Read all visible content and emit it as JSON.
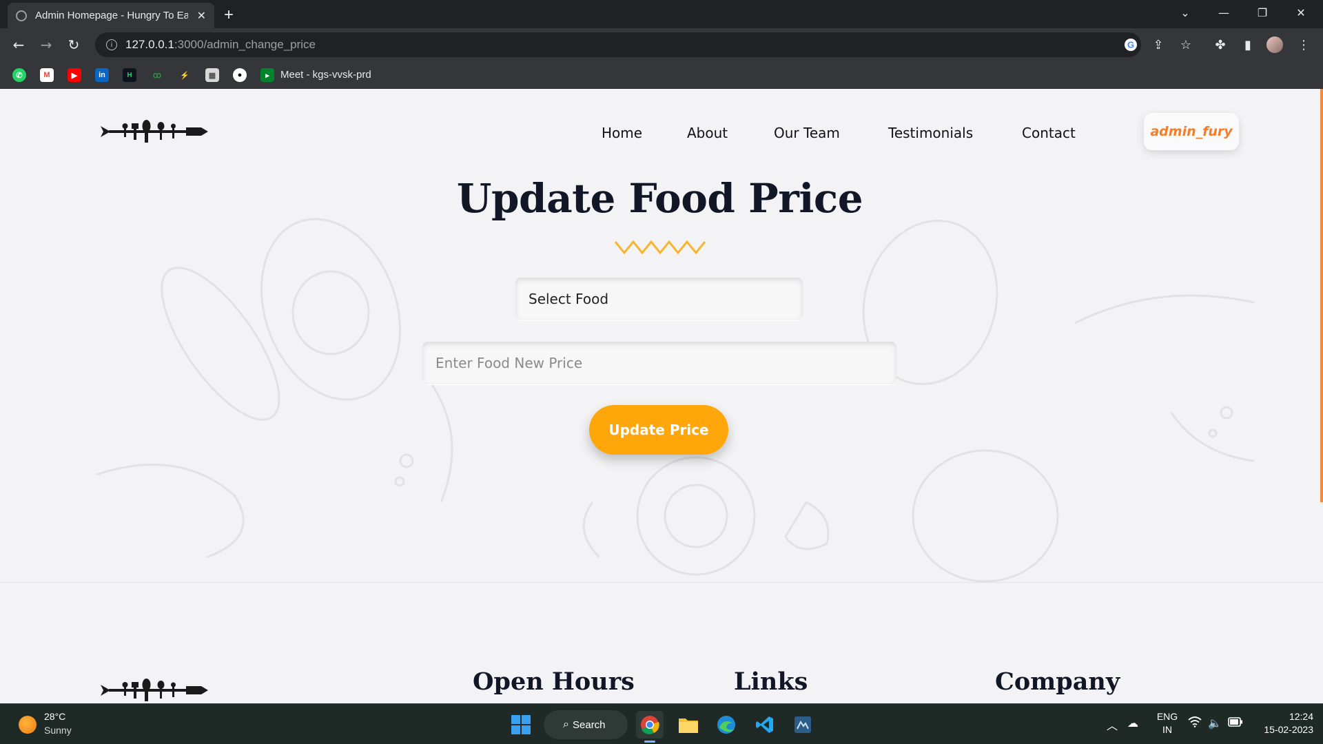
{
  "browser": {
    "tab_title": "Admin Homepage - Hungry To Eat",
    "url_host": "127.0.0.1",
    "url_path": ":3000/admin_change_price",
    "bookmark_meet_label": "Meet - kgs-vvsk-prd",
    "bookmarks": [
      "whatsapp",
      "gmail",
      "youtube",
      "linkedin",
      "hackerrank",
      "geeksforgeeks",
      "codechef",
      "image",
      "github",
      "google-meet"
    ]
  },
  "nav": {
    "items": [
      "Home",
      "About",
      "Our Team",
      "Testimonials",
      "Contact"
    ],
    "user_label": "admin_fury"
  },
  "main": {
    "heading": "Update Food Price",
    "select_placeholder": "Select Food",
    "price_placeholder": "Enter Food New Price",
    "submit_label": "Update Price"
  },
  "footer": {
    "headings": [
      "Open Hours",
      "Links",
      "Company"
    ]
  },
  "taskbar": {
    "weather_temp": "28°C",
    "weather_desc": "Sunny",
    "search_label": "Search",
    "lang_line1": "ENG",
    "lang_line2": "IN",
    "time": "12:24",
    "date": "15-02-2023"
  },
  "colors": {
    "accent_orange": "#ffa70a",
    "user_orange": "#f47d2a",
    "heading_navy": "#121727",
    "page_bg": "#f3f3f5"
  }
}
